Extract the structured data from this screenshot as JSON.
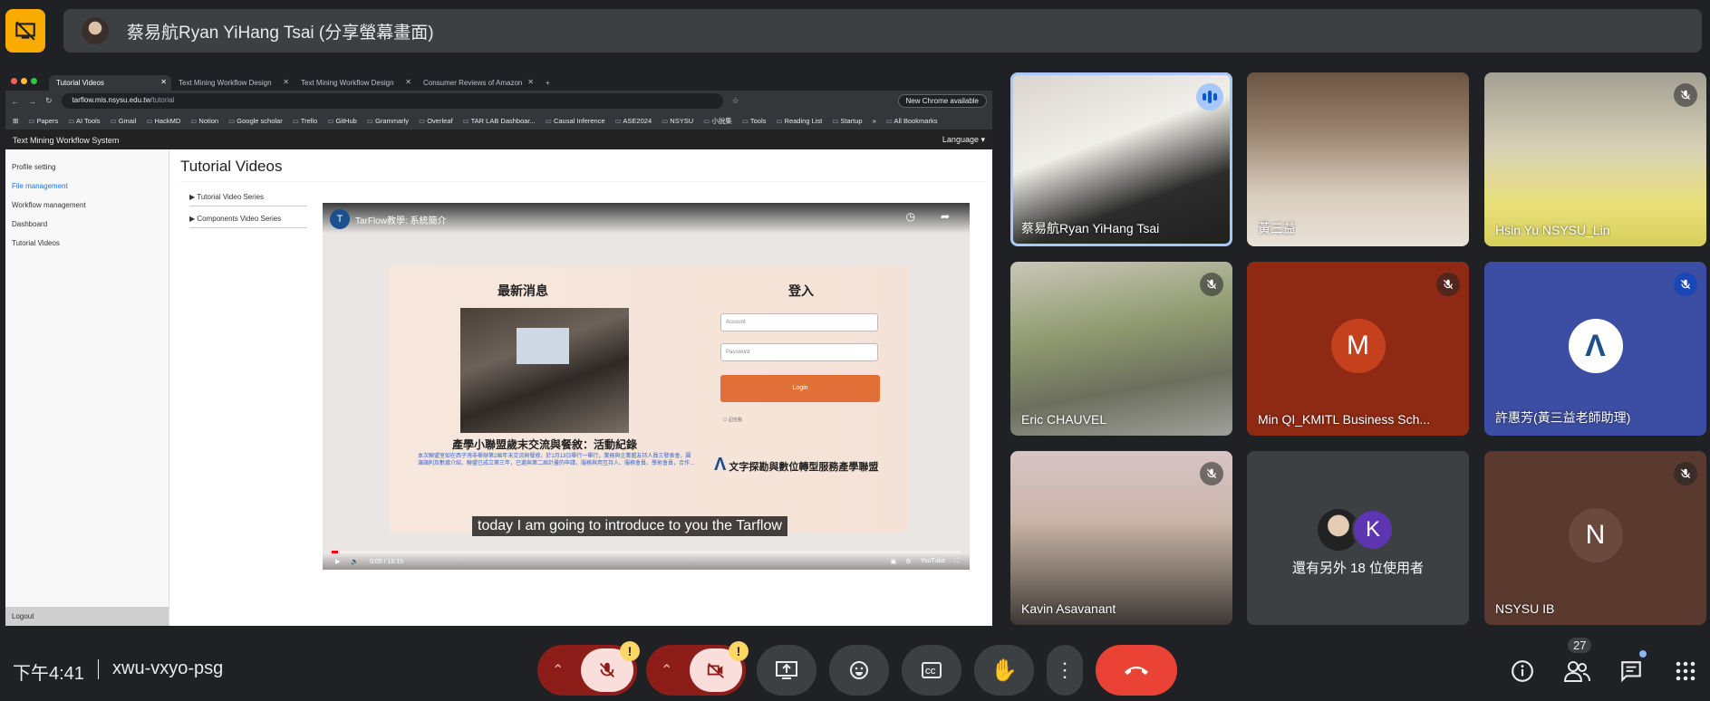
{
  "presenter": {
    "name": "蔡易航Ryan YiHang Tsai (分享螢幕畫面)"
  },
  "browser": {
    "tabs": [
      {
        "label": "Tutorial Videos"
      },
      {
        "label": "Text Mining Workflow Design"
      },
      {
        "label": "Text Mining Workflow Design"
      },
      {
        "label": "Consumer Reviews of Amazon"
      }
    ],
    "url_host": "tarflow.mis.nsysu.edu.tw",
    "url_path": "/tutorial",
    "new_chrome": "New Chrome available",
    "bookmarks": [
      "Papers",
      "AI Tools",
      "Gmail",
      "HackMD",
      "Notion",
      "Google scholar",
      "Trello",
      "GitHub",
      "Grammarly",
      "Overleaf",
      "TAR LAB Dashboar...",
      "Causal Inference",
      "ASE2024",
      "NSYSU",
      "小說集",
      "Tools",
      "Reading List",
      "Startup"
    ],
    "all_bookmarks": "All Bookmarks"
  },
  "app": {
    "title": "Text Mining Workflow System",
    "language": "Language",
    "sidebar": [
      {
        "label": "Profile setting"
      },
      {
        "label": "File management"
      },
      {
        "label": "Workflow management"
      },
      {
        "label": "Dashboard"
      },
      {
        "label": "Tutorial Videos"
      }
    ],
    "logout": "Logout",
    "page_title": "Tutorial Videos",
    "series": [
      {
        "label": "▶ Tutorial Video Series"
      },
      {
        "label": "▶ Components Video Series"
      }
    ]
  },
  "video": {
    "channel_letter": "T",
    "title": "TarFlow教學: 系統簡介",
    "slide_news_title": "最新消息",
    "slide_login_title": "登入",
    "slide_photo_caption": "產學小聯盟歲末交流與餐敘：活動紀錄",
    "slide_blue_text": "本次聯盟室如在西子灣非舉辦第2屆年末交流與餐敘，於1月13日舉行一舉行，業務與企業盟友持人員三發表會，圓滿順利及數據介紹，聯盟已成立第三年，已邀與第二屆計畫的申請，服務與用互持人、服務會員、學術會員，合作...",
    "account_placeholder": "Account",
    "password_placeholder": "Password",
    "login_button": "Login",
    "remember": "記住我",
    "logo_text": "文字探勘與數位轉型服務產學聯盟",
    "subtitle": "today I am going to introduce to you the Tarflow",
    "time": "0:05 / 16:15",
    "progress": 0.005,
    "youtube": "YouTube"
  },
  "participants": [
    {
      "name": "蔡易航Ryan YiHang Tsai",
      "status": "speaking"
    },
    {
      "name": "黃三益",
      "status": "none"
    },
    {
      "name": "Hsin Yu NSYSU_Lin",
      "status": "muted"
    },
    {
      "name": "Eric CHAUVEL",
      "status": "muted"
    },
    {
      "name": "Min QI_KMITL Business Sch...",
      "status": "muted",
      "avatar_letter": "M",
      "avatar_color": "#c5401c"
    },
    {
      "name": "許惠芳(黃三益老師助理)",
      "status": "muted-blue"
    },
    {
      "name": "Kavin Asavanant",
      "status": "muted"
    },
    {
      "name": "還有另外 18 位使用者",
      "status": "none",
      "avatar_letter": "K"
    },
    {
      "name": "NSYSU IB",
      "status": "muted",
      "avatar_letter": "N",
      "avatar_color": "#6b4a3d"
    }
  ],
  "bottom": {
    "clock": "下午4:41",
    "meeting_code": "xwu-vxyo-psg",
    "people_count": "27"
  },
  "colors": {
    "background": "#202124",
    "present_yellow": "#f9ab00",
    "end_call_red": "#ea4335",
    "muted_btn": "#f9dedc"
  }
}
